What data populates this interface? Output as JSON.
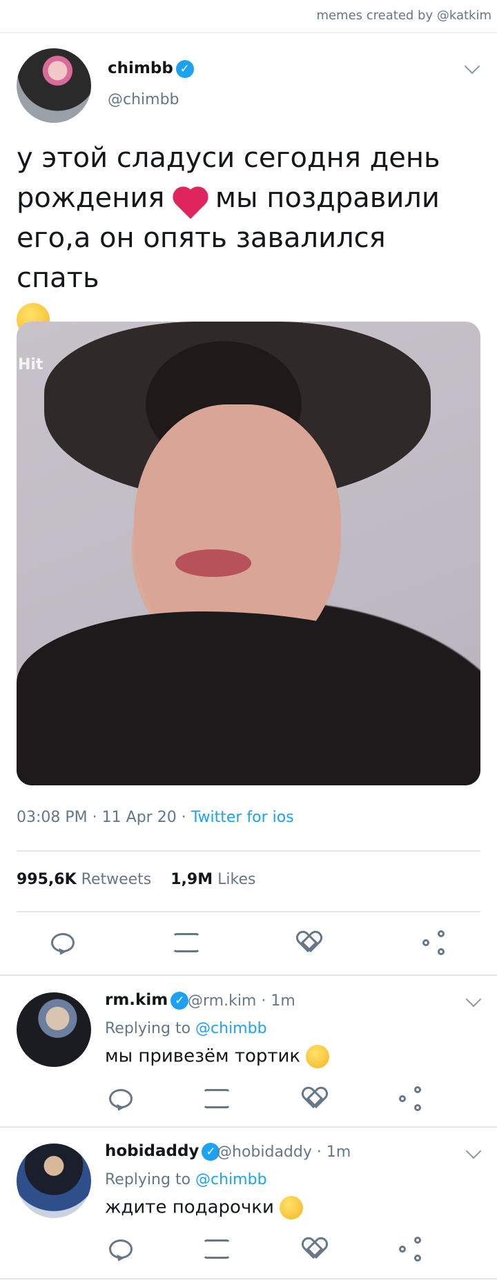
{
  "header": {
    "credit": "memes created by @katkim"
  },
  "tweet": {
    "name": "chimbb",
    "handle": "@chimbb",
    "text_line1": "у этой сладуси сегодня день",
    "text_line2a": "рождения",
    "text_line2b": "мы поздравили",
    "text_line3": "его,а он опять завалился спать",
    "emoji_1": "two-hearts-emoji",
    "emoji_2": "face-with-hand-over-mouth-emoji",
    "photo_watermark": "Hit",
    "time": "03:08 PM",
    "date": "11 Apr 20",
    "source": "Twitter for ios",
    "retweets_count": "995,6K",
    "retweets_label": "Retweets",
    "likes_count": "1,9M",
    "likes_label": "Likes"
  },
  "replies": [
    {
      "name": "rm.kim",
      "handle": "@rm.kim",
      "time": "1m",
      "replying_label": "Replying to",
      "mention": "@chimbb",
      "text": "мы привезём тортик",
      "emoji": "upside-down-face-emoji"
    },
    {
      "name": "hobidaddy",
      "handle": "@hobidaddy",
      "time": "1m",
      "replying_label": "Replying to",
      "mention": "@chimbb",
      "text": "ждите подарочки",
      "emoji": "zany-face-emoji"
    }
  ],
  "colors": {
    "accent": "#1da1f2",
    "muted": "#657786",
    "divider": "#e1e8ed",
    "text": "#14171a"
  }
}
